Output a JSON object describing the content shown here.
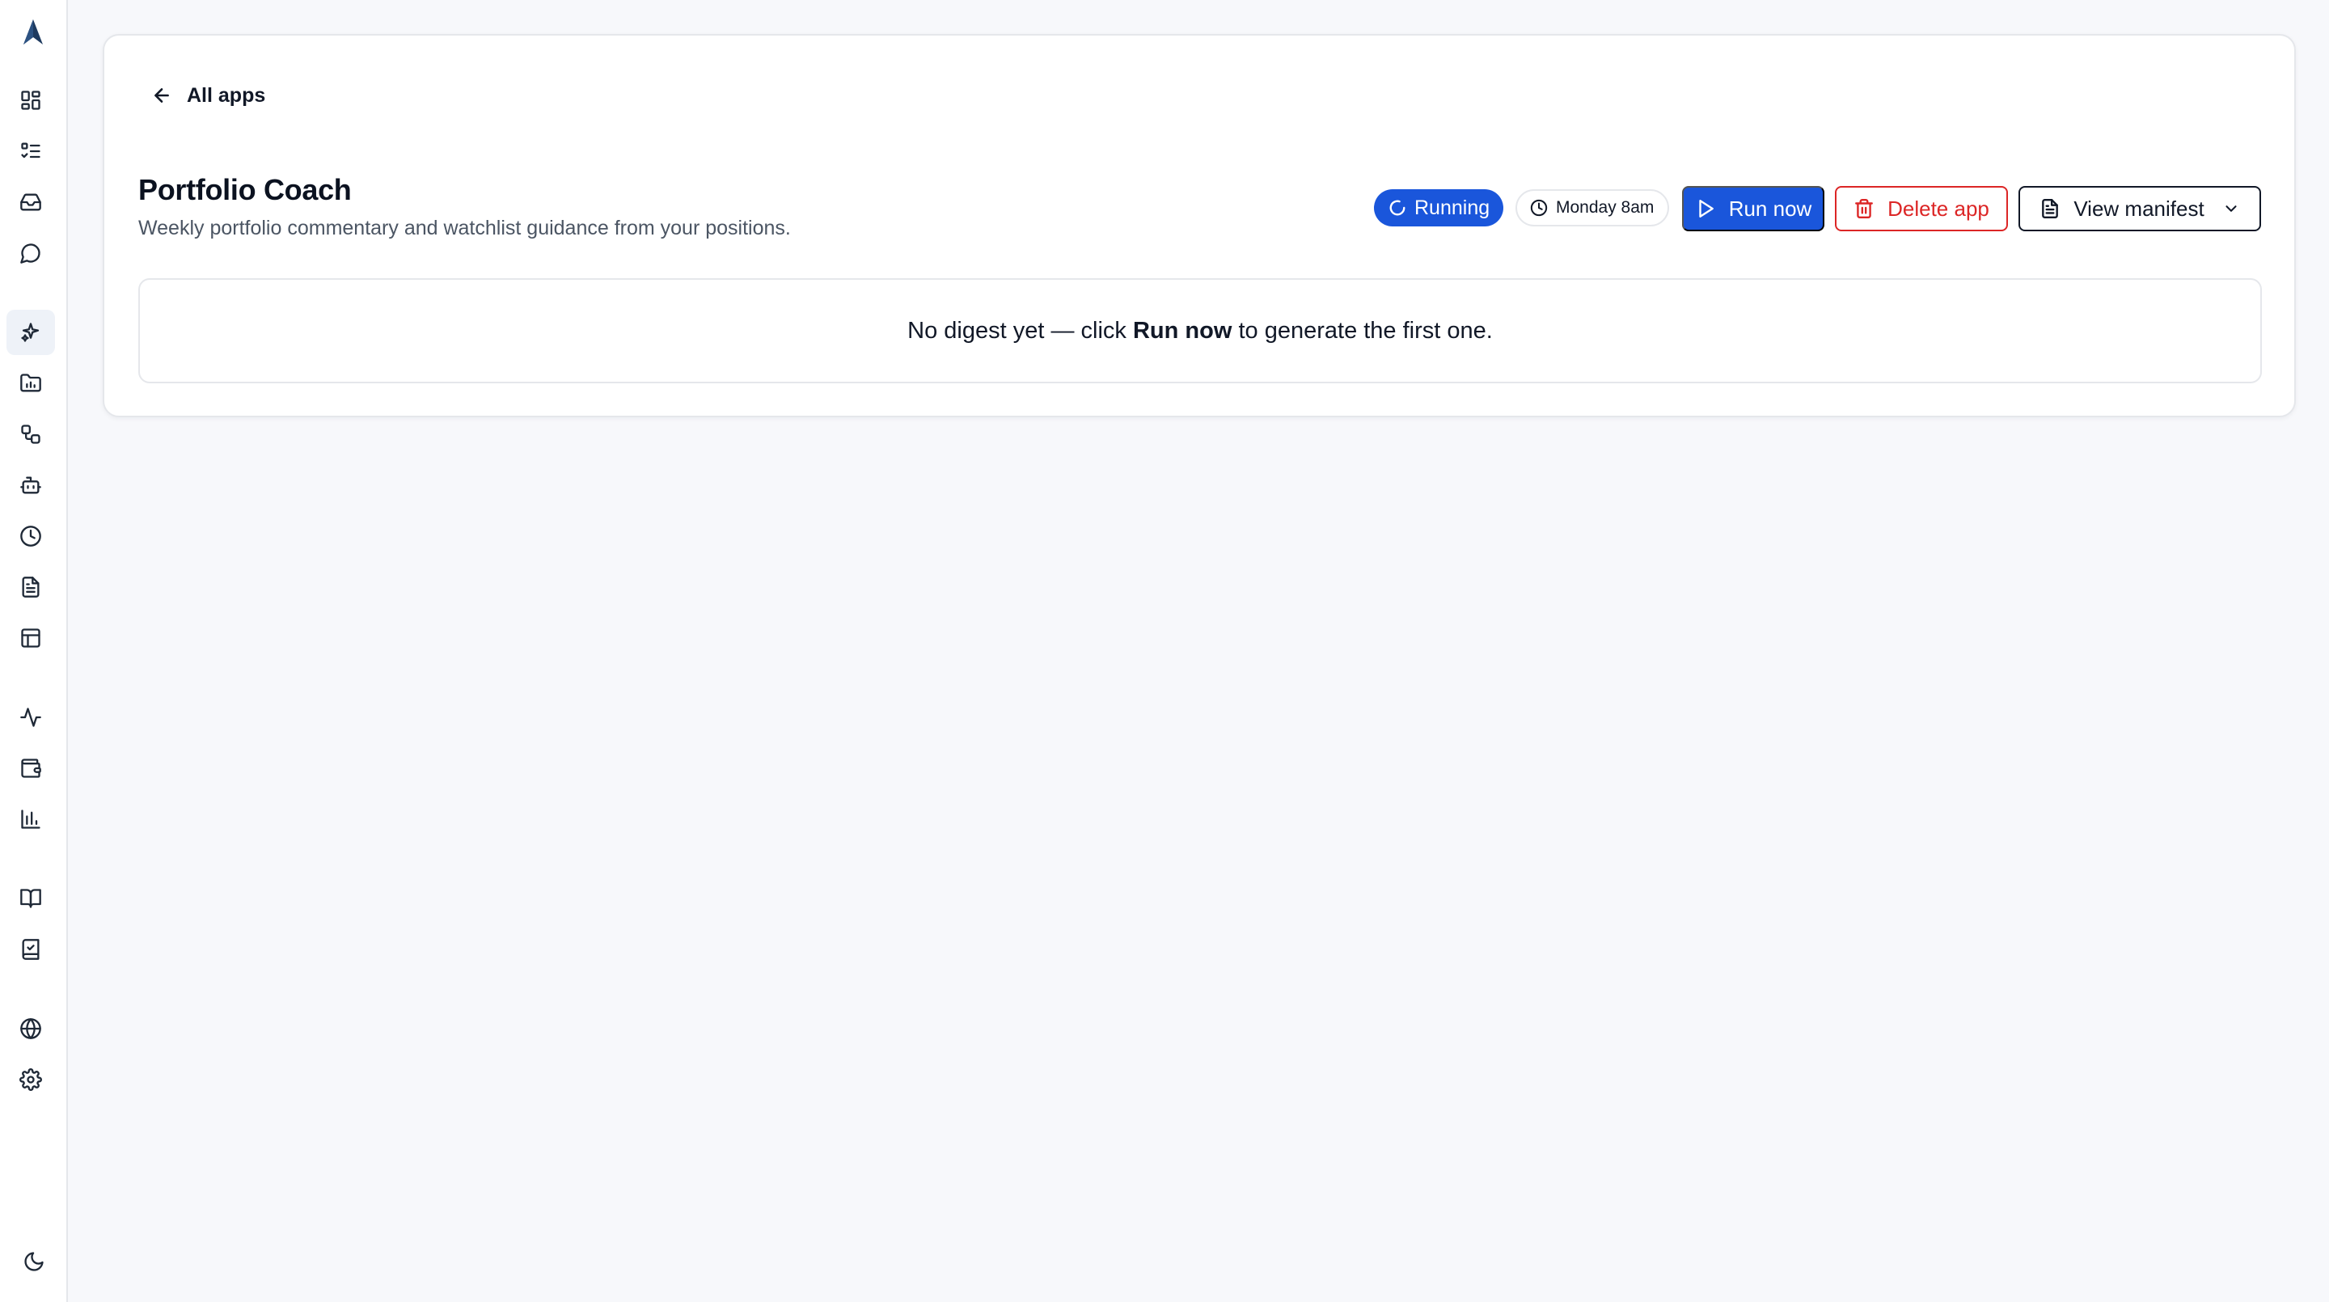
{
  "sidebar": {
    "logo_icon": "arrow-logo-icon",
    "items": [
      {
        "icon": "dashboard-grid-icon"
      },
      {
        "icon": "list-checks-icon"
      },
      {
        "icon": "inbox-icon"
      },
      {
        "icon": "chat-bubble-icon"
      },
      {
        "icon": "sparkles-icon",
        "active": true
      },
      {
        "icon": "folder-chart-icon"
      },
      {
        "icon": "workflow-icon"
      },
      {
        "icon": "bot-icon"
      },
      {
        "icon": "clock-icon"
      },
      {
        "icon": "document-icon"
      },
      {
        "icon": "table-icon"
      },
      {
        "icon": "activity-icon"
      },
      {
        "icon": "wallet-icon"
      },
      {
        "icon": "bar-chart-icon"
      },
      {
        "icon": "book-open-icon"
      },
      {
        "icon": "notebook-icon"
      },
      {
        "icon": "globe-icon"
      },
      {
        "icon": "settings-gear-icon"
      }
    ],
    "theme_icon": "moon-icon"
  },
  "header": {
    "back_label": "All apps"
  },
  "app": {
    "title": "Portfolio Coach",
    "description": "Weekly portfolio commentary and watchlist guidance from your positions.",
    "status": "Running",
    "schedule": "Monday 8am"
  },
  "actions": {
    "run_label": "Run now",
    "delete_label": "Delete app",
    "manifest_label": "View manifest"
  },
  "empty_state": {
    "prefix": "No digest yet — click ",
    "emphasis": "Run now",
    "suffix": " to generate the first one."
  },
  "colors": {
    "primary": "#1a56db",
    "danger": "#dc2626",
    "background": "#f7f8fb"
  }
}
